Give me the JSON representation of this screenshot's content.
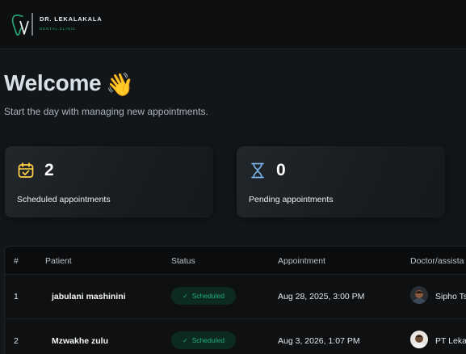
{
  "header": {
    "brand_name": "DR. LEKALAKALA",
    "brand_sub": "DENTAL CLINIC",
    "logo_icon": "tooth-logo-icon"
  },
  "welcome": {
    "title": "Welcome",
    "emoji": "👋",
    "subtitle": "Start the day with managing new appointments."
  },
  "stats": [
    {
      "icon": "calendar-check-icon",
      "count": "2",
      "label": "Scheduled appointments",
      "accent": "#ffd147"
    },
    {
      "icon": "hourglass-icon",
      "count": "0",
      "label": "Pending appointments",
      "accent": "#79b5ec"
    }
  ],
  "table": {
    "columns": [
      "#",
      "Patient",
      "Status",
      "Appointment",
      "Doctor/assista"
    ],
    "rows": [
      {
        "num": "1",
        "patient": "jabulani mashinini",
        "status": "Scheduled",
        "appointment": "Aug 28, 2025, 3:00 PM",
        "doctor": "Sipho Ts"
      },
      {
        "num": "2",
        "patient": "Mzwakhe zulu",
        "status": "Scheduled",
        "appointment": "Aug 3, 2026, 1:07 PM",
        "doctor": "PT Lekal"
      }
    ]
  },
  "colors": {
    "background": "#131619",
    "brand_green": "#24ae7c",
    "status_green_bg": "#0d2a1f"
  }
}
